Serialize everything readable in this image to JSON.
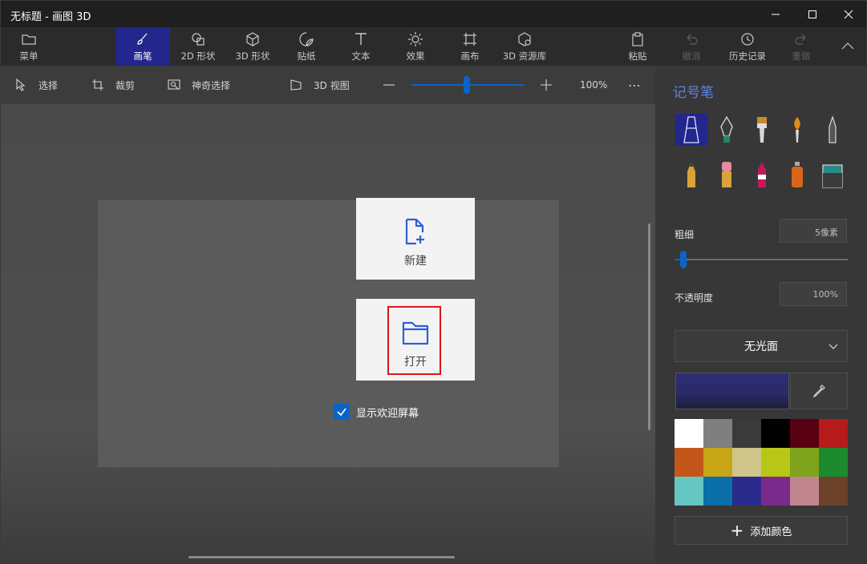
{
  "window": {
    "title": "无标题 - 画图 3D"
  },
  "ribbon": {
    "menu": "菜单",
    "brushes": "画笔",
    "shapes2d": "2D 形状",
    "shapes3d": "3D 形状",
    "stickers": "贴纸",
    "text": "文本",
    "effects": "效果",
    "canvas": "画布",
    "library3d": "3D 资源库",
    "paste": "粘贴",
    "undo": "撤消",
    "history": "历史记录",
    "redo": "重做"
  },
  "toolbar": {
    "select": "选择",
    "crop": "裁剪",
    "magic_select": "神奇选择",
    "view3d": "3D 视图",
    "zoom_value": "100%",
    "zoom_level": 0.47
  },
  "welcome": {
    "new_label": "新建",
    "open_label": "打开",
    "show_welcome_label": "显示欢迎屏幕",
    "show_welcome_checked": true
  },
  "panel": {
    "title": "记号笔",
    "thickness_label": "粗细",
    "thickness_value": "5像素",
    "opacity_label": "不透明度",
    "opacity_value": "100%",
    "finish": "无光面",
    "add_color": "添加颜色",
    "current_color": "#2a2a6a",
    "palette": [
      "#ffffff",
      "#7f7f7f",
      "#3a3a3a",
      "#000000",
      "#5a0013",
      "#b61a1a",
      "#c4561a",
      "#c7a517",
      "#cfc48a",
      "#b8c617",
      "#7fa31c",
      "#1d8a2d",
      "#65c7c2",
      "#0a6fa6",
      "#2a2a8a",
      "#7a2a8a",
      "#c1858f",
      "#6b4229"
    ]
  }
}
